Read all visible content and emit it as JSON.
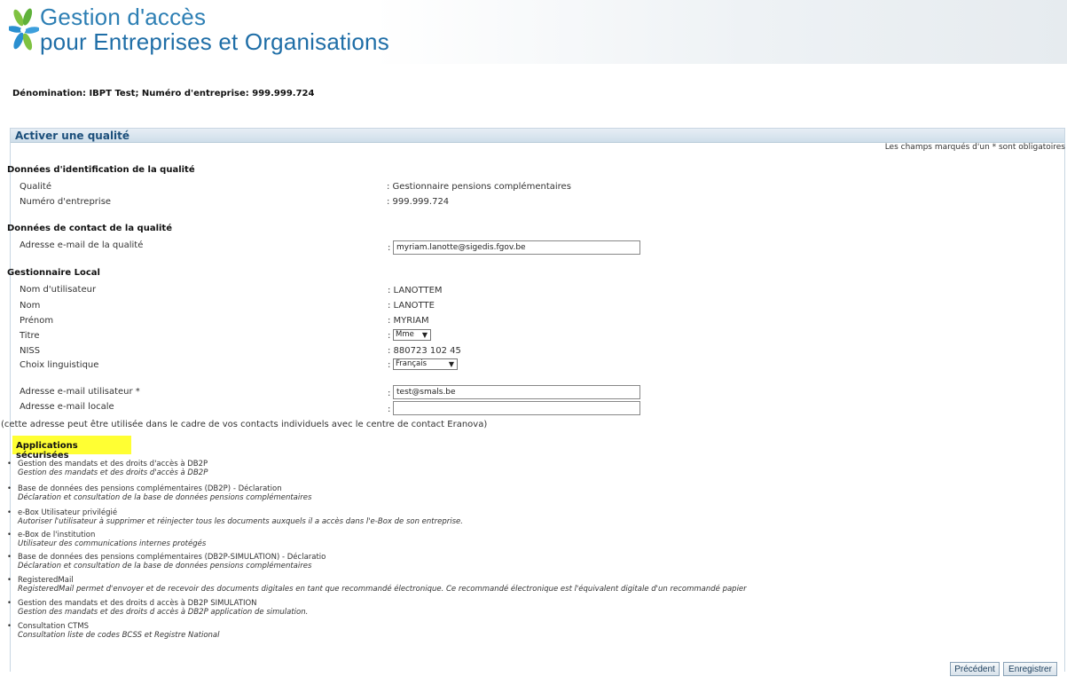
{
  "header": {
    "brand_line1": "Gestion d'accès",
    "brand_line2": "pour Entreprises et Organisations",
    "logo_icon": "flower-logo-icon",
    "colors": {
      "brand": "#2d7fb4",
      "logo_green": "#7fc241",
      "logo_blue": "#2a8fd0"
    }
  },
  "denomination": "Dénomination: IBPT Test; Numéro d'entreprise: 999.999.724",
  "panel": {
    "title": "Activer une qualité",
    "required_note": "Les champs marqués d'un * sont obligatoires"
  },
  "identification": {
    "heading": "Données d'identification de la qualité",
    "qualite_label": "Qualité",
    "qualite_value": ": Gestionnaire pensions complémentaires",
    "numero_label": "Numéro d'entreprise",
    "numero_value": ": 999.999.724"
  },
  "contact": {
    "heading": "Données de contact de la qualité",
    "email_label": "Adresse e-mail de la qualité",
    "email_value": "myriam.lanotte@sigedis.fgov.be"
  },
  "local": {
    "heading": "Gestionnaire Local",
    "username_label": "Nom d'utilisateur",
    "username_value": ": LANOTTEM",
    "nom_label": "Nom",
    "nom_value": ": LANOTTE",
    "prenom_label": "Prénom",
    "prenom_value": ": MYRIAM",
    "titre_label": "Titre",
    "titre_value": "Mme",
    "niss_label": "NISS",
    "niss_value": ": 880723 102 45",
    "langue_label": "Choix linguistique",
    "langue_value": "Français",
    "user_email_label": "Adresse e-mail utilisateur *",
    "user_email_value": "test@smals.be",
    "local_email_label": "Adresse e-mail locale",
    "local_email_value": "",
    "colon": ":"
  },
  "note": "(cette adresse peut être utilisée dans le cadre de vos contacts individuels avec le centre de contact Eranova)",
  "applications": {
    "heading": "Applications sécurisées",
    "items": [
      {
        "title": "Gestion des mandats et des droits d'accès à DB2P",
        "desc": "Gestion des mandats et des droits d'accès à DB2P"
      },
      {
        "title": "Base de données des pensions complémentaires (DB2P) - Déclaration",
        "desc": "Déclaration et consultation de la base de données pensions complémentaires"
      },
      {
        "title": "e-Box Utilisateur privilégié",
        "desc": "Autoriser l'utilisateur à supprimer et réinjecter tous les documents auxquels il a accès dans l'e-Box de son entreprise."
      },
      {
        "title": "e-Box de l'institution",
        "desc": "Utilisateur des communications internes protégés"
      },
      {
        "title": "Base de données des pensions complémentaires (DB2P-SIMULATION) - Déclaratio",
        "desc": "Déclaration et consultation de la base de données pensions complémentaires"
      },
      {
        "title": "RegisteredMail",
        "desc": "RegisteredMail permet d'envoyer et de recevoir des documents digitales en tant que recommandé électronique. Ce recommandé électronique est l'équivalent digitale d'un recommandé papier"
      },
      {
        "title": "Gestion des mandats et des droits d accès à DB2P SIMULATION",
        "desc": "Gestion des mandats et des droits d accès à DB2P application de simulation."
      },
      {
        "title": "Consultation CTMS",
        "desc": "Consultation liste de codes BCSS et Registre National"
      }
    ],
    "highlight_color": "#ffff33"
  },
  "buttons": {
    "previous": "Précédent",
    "save": "Enregistrer"
  },
  "select_arrow": "▼",
  "bullet": "•"
}
